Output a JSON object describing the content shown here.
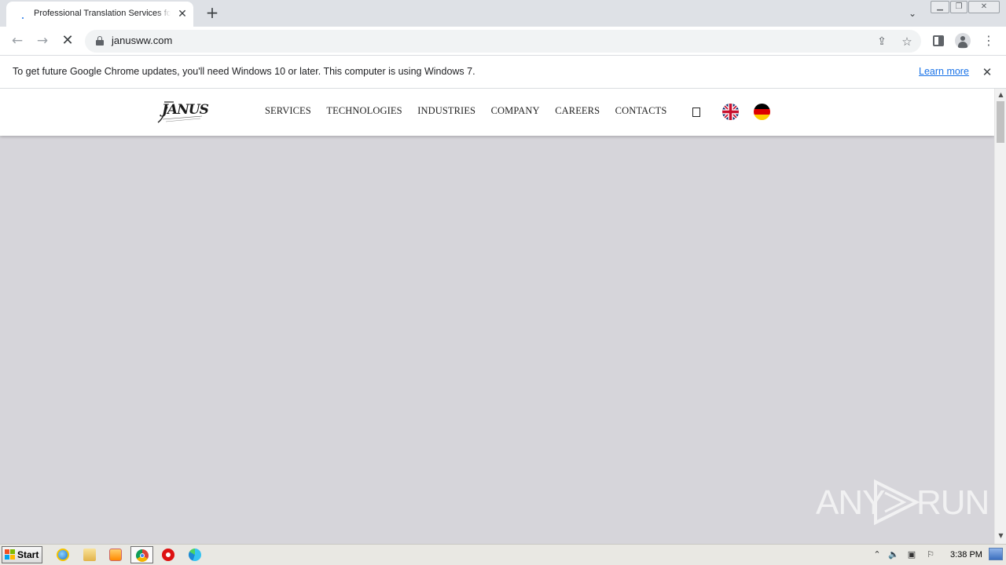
{
  "browser": {
    "tab": {
      "title": "Professional Translation Services for",
      "close_icon": "close-icon"
    },
    "new_tab_label": "+",
    "address_bar": {
      "url": "janusww.com",
      "secure_icon": "lock-icon"
    },
    "window_controls": [
      "minimize",
      "restore",
      "close"
    ]
  },
  "infobar": {
    "message": "To get future Google Chrome updates, you'll need Windows 10 or later. This computer is using Windows 7.",
    "link_label": "Learn more"
  },
  "site": {
    "logo_text": "JANUS",
    "nav": [
      {
        "label": "SERVICES"
      },
      {
        "label": "TECHNOLOGIES"
      },
      {
        "label": "INDUSTRIES"
      },
      {
        "label": "COMPANY"
      },
      {
        "label": "CAREERS"
      },
      {
        "label": "CONTACTS"
      }
    ],
    "languages": [
      "English",
      "German"
    ]
  },
  "watermark": {
    "left": "ANY",
    "right": "RUN"
  },
  "taskbar": {
    "start_label": "Start",
    "pinned_apps": [
      "internet-explorer",
      "file-explorer",
      "media-player",
      "chrome",
      "opera",
      "edge"
    ],
    "active_app": "chrome",
    "clock": "3:38 PM"
  },
  "colors": {
    "page_background": "#d6d5da",
    "link": "#1a73e8",
    "accent_chrome_tab": "#dee1e6"
  }
}
